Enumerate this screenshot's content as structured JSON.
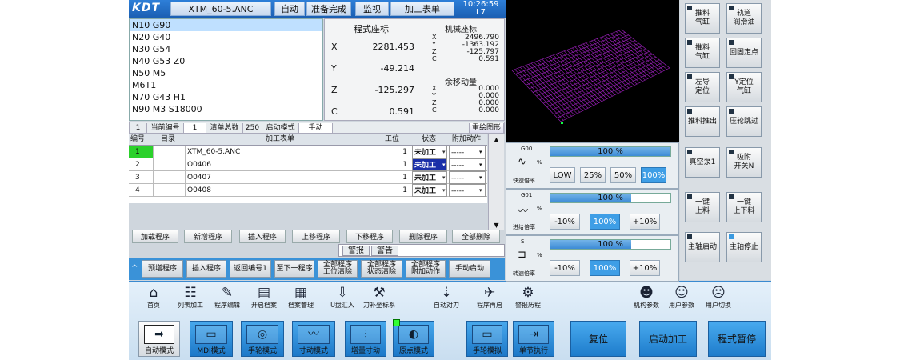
{
  "header": {
    "logo": "KDT",
    "file": "XTM_60-5.ANC",
    "mode": "自动",
    "state": "准备完成",
    "monitor": "监视",
    "worklist": "加工表单",
    "time": "10:26:59",
    "sub": "L7"
  },
  "code_lines": [
    "N10 G90",
    "N20 G40",
    "N30 G54",
    "N40 G53 Z0",
    "N50 M5",
    "M6T1",
    "N70 G43 H1",
    "N90 M3 S18000"
  ],
  "coords": {
    "title": "程式座标",
    "mach_title": "机械座标",
    "remain_title": "余移动量",
    "prog": [
      {
        "axis": "X",
        "val": "2281.453"
      },
      {
        "axis": "Y",
        "val": "-49.214"
      },
      {
        "axis": "Z",
        "val": "-125.297"
      },
      {
        "axis": "C",
        "val": "0.591"
      }
    ],
    "mach": [
      {
        "axis": "X",
        "val": "2496.790"
      },
      {
        "axis": "Y",
        "val": "-1363.192"
      },
      {
        "axis": "Z",
        "val": "-125.797"
      },
      {
        "axis": "C",
        "val": "0.591"
      }
    ],
    "remain": [
      {
        "axis": "X",
        "val": "0.000"
      },
      {
        "axis": "Y",
        "val": "0.000"
      },
      {
        "axis": "Z",
        "val": "0.000"
      },
      {
        "axis": "C",
        "val": "0.000"
      }
    ]
  },
  "infobar": {
    "n1": "1",
    "cur_label": "当前编号",
    "cur": "1",
    "total_label": "清单总数",
    "total": "250",
    "start_label": "启动模式",
    "start": "手动",
    "redraw": "重绘图形"
  },
  "table": {
    "headers": [
      "编号",
      "目录",
      "加工表单",
      "工位",
      "状态",
      "附加动作"
    ],
    "rows": [
      {
        "no": "1",
        "file": "XTM_60-5.ANC",
        "pos": "1",
        "status": "未加工",
        "act": "-----"
      },
      {
        "no": "2",
        "file": "O0406",
        "pos": "1",
        "status": "未加工",
        "act": "-----"
      },
      {
        "no": "3",
        "file": "O0407",
        "pos": "1",
        "status": "未加工",
        "act": "-----"
      },
      {
        "no": "4",
        "file": "O0408",
        "pos": "1",
        "status": "未加工",
        "act": "-----"
      }
    ]
  },
  "actions": [
    "加载程序",
    "新增程序",
    "插入程序",
    "上移程序",
    "下移程序",
    "删除程序",
    "全部删除"
  ],
  "alarm": {
    "label1": "警报",
    "label2": "警告"
  },
  "funcbar": [
    "预增程序",
    "插入程序",
    "返回编号1",
    "至下一程序",
    "全部程序\n工位清除",
    "全部程序\n状态清除",
    "全部程序\n附加动作",
    "手动启动"
  ],
  "overrides": [
    {
      "code": "G00",
      "pct": "100 %",
      "fill": 1.0,
      "unit": "%",
      "label": "快速倍率",
      "buttons": [
        "LOW",
        "25%",
        "50%",
        "100%"
      ],
      "active": 3
    },
    {
      "code": "G01",
      "pct": "100 %",
      "fill": 0.67,
      "unit": "%",
      "label": "进给倍率",
      "buttons": [
        "-10%",
        "100%",
        "+10%"
      ],
      "active": 1
    },
    {
      "code": "S",
      "pct": "100 %",
      "fill": 0.67,
      "unit": "%",
      "label": "转速倍率",
      "buttons": [
        "-10%",
        "100%",
        "+10%"
      ],
      "active": 1
    }
  ],
  "side": [
    "推料\n气缸",
    "轨道\n润滑油",
    "推料\n气缸",
    "回固定点",
    "左导\n定位",
    "Y定位\n气缸",
    "推料推出",
    "压轮跳过",
    "真空泵1",
    "吸附\n开关N",
    "一键\n上料",
    "一键\n上下料",
    "主轴启动",
    "主轴停止"
  ],
  "nav": [
    {
      "icon": "home-icon",
      "g": "⌂",
      "label": "首页"
    },
    {
      "icon": "list-icon",
      "g": "☷",
      "label": "列表加工"
    },
    {
      "icon": "program-edit-icon",
      "g": "✎",
      "label": "程序编辑"
    },
    {
      "icon": "folder-open-icon",
      "g": "▤",
      "label": "开启档案"
    },
    {
      "icon": "file-manage-icon",
      "g": "▦",
      "label": "档案管理"
    },
    {
      "icon": "usb-icon",
      "g": "⇩",
      "label": "U盘汇入"
    },
    {
      "icon": "tool-coord-icon",
      "g": "⚒",
      "label": "刀补坐标系"
    },
    {
      "icon": "auto-tool-icon",
      "g": "⇣",
      "label": "自动对刀"
    },
    {
      "icon": "restart-icon",
      "g": "✈",
      "label": "程序再启"
    },
    {
      "icon": "gear-icon",
      "g": "⚙",
      "label": "警报历程"
    },
    {
      "icon": "machine-param-icon",
      "g": "☻",
      "label": "机构参数"
    },
    {
      "icon": "user-param-icon",
      "g": "☺",
      "label": "用户参数"
    },
    {
      "icon": "user-switch-icon",
      "g": "☹",
      "label": "用户切换"
    }
  ],
  "modes": [
    {
      "icon": "arrow-right-icon",
      "g": "➡",
      "label": "自动模式"
    },
    {
      "icon": "mdi-icon",
      "g": "▭",
      "label": "MDI模式"
    },
    {
      "icon": "handwheel-icon",
      "g": "◎",
      "label": "手轮模式"
    },
    {
      "icon": "jog-icon",
      "g": "〰",
      "label": "寸动模式"
    },
    {
      "icon": "inc-jog-icon",
      "g": "⫶",
      "label": "增量寸动"
    },
    {
      "icon": "origin-icon",
      "g": "◐",
      "label": "原点模式"
    },
    {
      "icon": "handwheel-sim-icon",
      "g": "▭",
      "label": "手轮模拟"
    },
    {
      "icon": "single-step-icon",
      "g": "⇥",
      "label": "单节执行"
    }
  ],
  "big": [
    "复位",
    "启动加工",
    "程式暂停"
  ]
}
